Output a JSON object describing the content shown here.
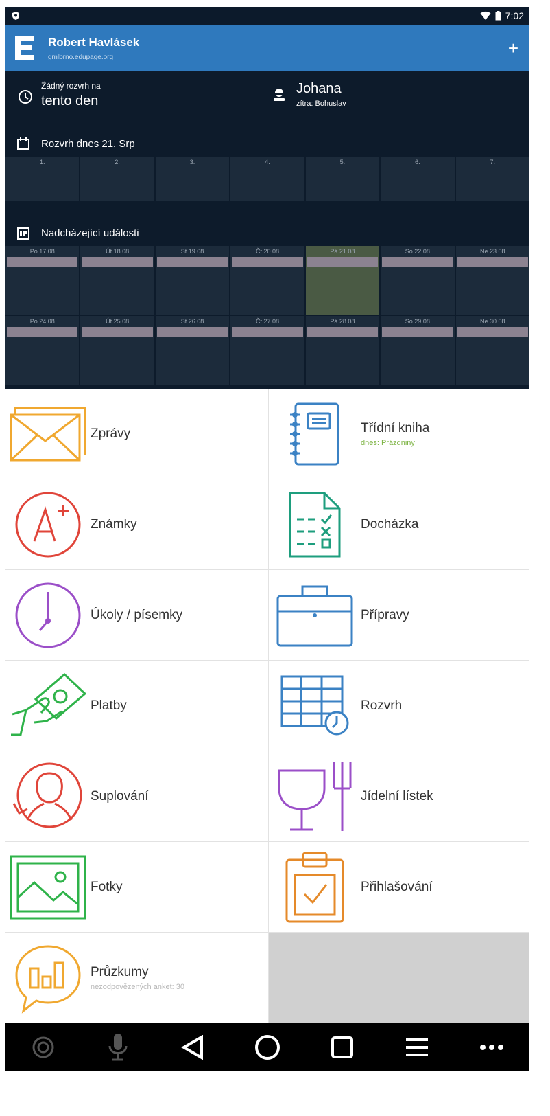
{
  "status_bar": {
    "time": "7:02",
    "icons": [
      "shield-icon",
      "wifi-icon",
      "battery-icon"
    ]
  },
  "app_bar": {
    "logo": "E",
    "user_name": "Robert Havlásek",
    "domain": "gmlbrno.edupage.org",
    "add_label": "+"
  },
  "today": {
    "no_timetable_small": "Žádný rozvrh na",
    "no_timetable_big": "tento den",
    "nameday_name": "Johana",
    "nameday_tomorrow": "zítra: Bohuslav"
  },
  "timetable": {
    "title": "Rozvrh dnes 21. Srp",
    "periods": [
      "1.",
      "2.",
      "3.",
      "4.",
      "5.",
      "6.",
      "7."
    ]
  },
  "events": {
    "title": "Nadcházející události",
    "week1": [
      "Po 17.08",
      "Út 18.08",
      "St 19.08",
      "Čt 20.08",
      "Pá 21.08",
      "So 22.08",
      "Ne 23.08"
    ],
    "week2": [
      "Po 24.08",
      "Út 25.08",
      "St 26.08",
      "Čt 27.08",
      "Pá 28.08",
      "So 29.08",
      "Ne 30.08"
    ]
  },
  "menu": {
    "zpravy": "Zprávy",
    "tridni_kniha": "Třídní kniha",
    "tridni_kniha_sub": "dnes: Prázdniny",
    "znamky": "Známky",
    "dochazka": "Docházka",
    "ukoly": "Úkoly / písemky",
    "pripravy": "Přípravy",
    "platby": "Platby",
    "rozvrh": "Rozvrh",
    "suplovani": "Suplování",
    "jidelni_listek": "Jídelní lístek",
    "fotky": "Fotky",
    "prihlasovani": "Přihlašování",
    "pruzkumy": "Průzkumy",
    "pruzkumy_sub": "nezodpovězených anket: 30"
  },
  "colors": {
    "app_bar": "#2f79bd",
    "dark_panel": "#0d1b2b",
    "orange": "#f0a830",
    "blue": "#3b82c4",
    "red": "#e0453a",
    "teal": "#1e9e7e",
    "purple": "#9b4fc8",
    "green": "#2fb34a",
    "dark_orange": "#e58a2a",
    "green_sub": "#7cb342"
  },
  "nav_bar": {
    "icons": [
      "camera-icon",
      "mic-icon",
      "back-icon",
      "home-icon",
      "recents-icon",
      "menu-icon",
      "more-icon"
    ]
  }
}
